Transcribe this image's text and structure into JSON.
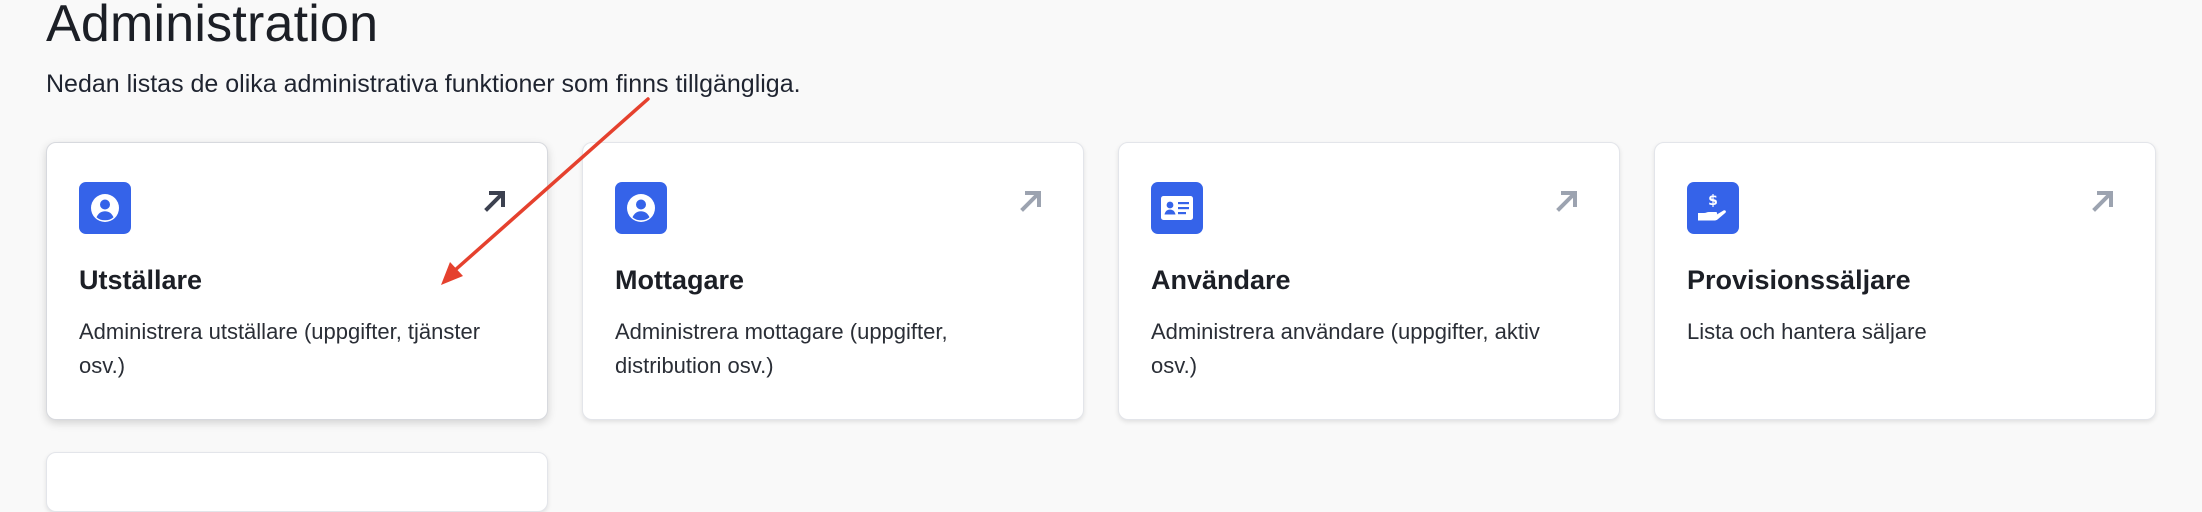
{
  "page": {
    "title": "Administration",
    "description": "Nedan listas de olika administrativa funktioner som finns tillgängliga."
  },
  "cards": [
    {
      "title": "Utställare",
      "description": "Administrera utställare (uppgifter, tjänster osv.)",
      "icon": "user-circle-icon",
      "arrow_icon": "arrow-up-right-icon",
      "arrow_color": "#3c4150"
    },
    {
      "title": "Mottagare",
      "description": "Administrera mottagare (uppgifter, distribution osv.)",
      "icon": "user-circle-icon",
      "arrow_icon": "arrow-up-right-icon",
      "arrow_color": "#9ca3b0"
    },
    {
      "title": "Användare",
      "description": "Administrera användare (uppgifter, aktiv osv.)",
      "icon": "id-card-icon",
      "arrow_icon": "arrow-up-right-icon",
      "arrow_color": "#9ca3b0"
    },
    {
      "title": "Provisionssäljare",
      "description": "Lista och hantera säljare",
      "icon": "hand-dollar-icon",
      "arrow_icon": "arrow-up-right-icon",
      "arrow_color": "#9ca3b0"
    }
  ],
  "colors": {
    "background": "#f9f9f9",
    "card_background": "#ffffff",
    "icon_background": "#3563e9",
    "annotation_arrow": "#e5412e"
  }
}
